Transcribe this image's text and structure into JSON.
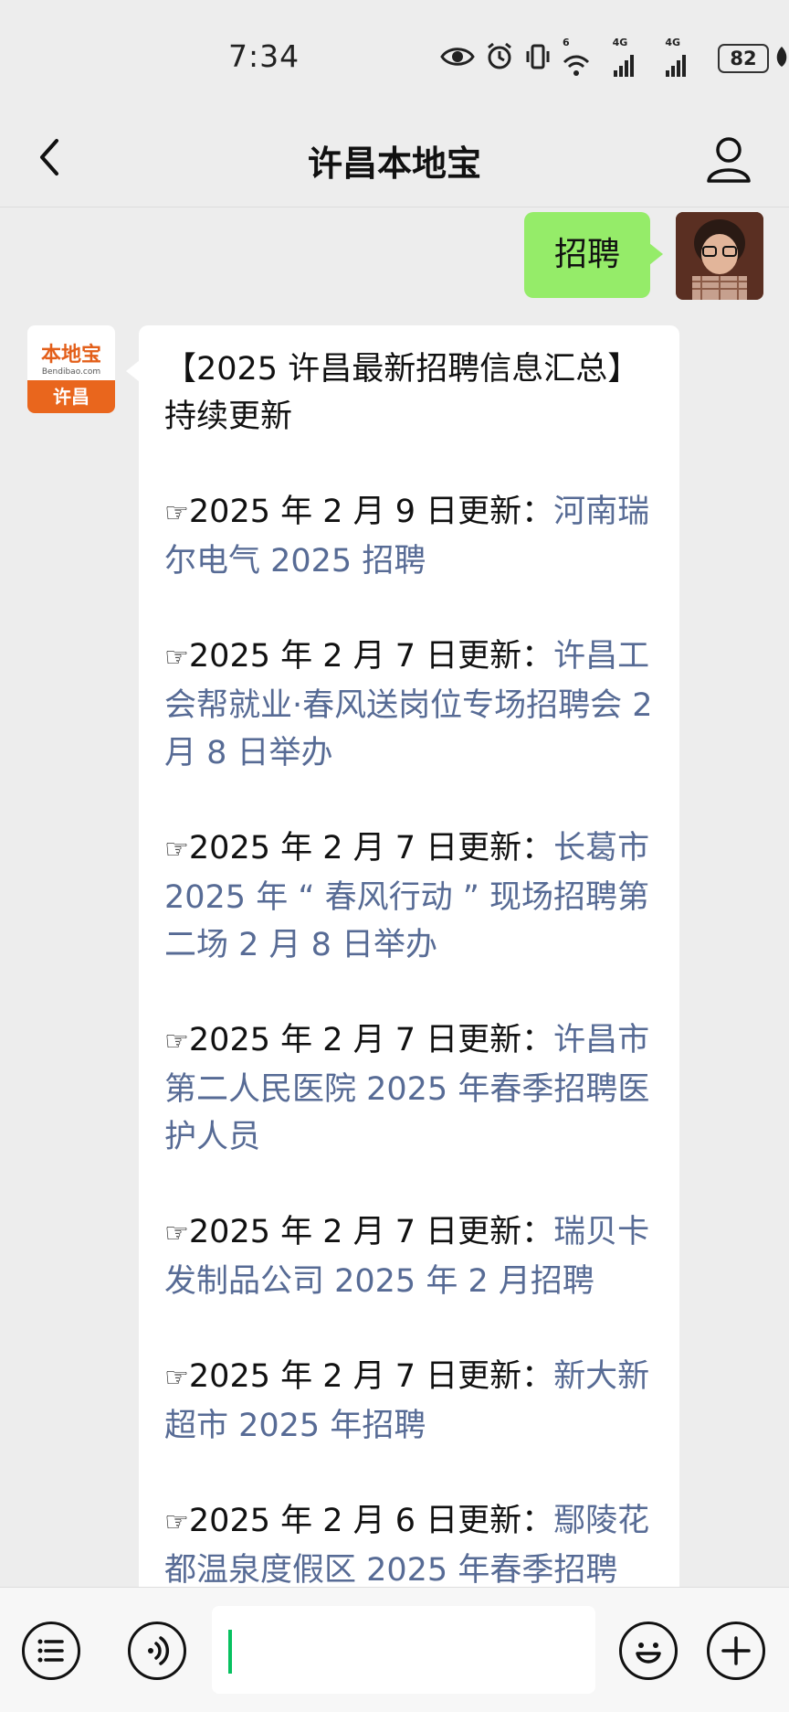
{
  "status_bar": {
    "time": "7:34",
    "signal_badge_1": "4G",
    "signal_badge_2": "4G",
    "wifi_badge": "6",
    "battery": "82"
  },
  "header": {
    "title": "许昌本地宝"
  },
  "user_message": {
    "text": "招聘"
  },
  "bot_avatar": {
    "top_text": "本地宝",
    "url_text": "Bendibao.com",
    "bottom_text": "许昌"
  },
  "bot_message": {
    "title": "【2025 许昌最新招聘信息汇总】持续更新",
    "hand_glyph": "☞",
    "entries": [
      {
        "date": "2025 年 2 月 9 日更新：",
        "link": "河南瑞尔电气 2025 招聘"
      },
      {
        "date": "2025 年 2 月 7 日更新：",
        "link": "许昌工会帮就业·春风送岗位专场招聘会 2 月 8 日举办"
      },
      {
        "date": "2025 年 2 月 7 日更新：",
        "link": "长葛市 2025 年 “ 春风行动 ” 现场招聘第二场 2 月 8 日举办"
      },
      {
        "date": "2025 年 2 月 7 日更新：",
        "link": "许昌市第二人民医院 2025 年春季招聘医护人员"
      },
      {
        "date": "2025 年 2 月 7 日更新：",
        "link": "瑞贝卡发制品公司 2025 年 2 月招聘"
      },
      {
        "date": "2025 年 2 月 7 日更新：",
        "link": "新大新超市 2025 年招聘"
      },
      {
        "date": "2025 年 2 月 6 日更新：",
        "link": "鄢陵花都温泉度假区 2025 年春季招聘"
      }
    ]
  },
  "colors": {
    "link": "#576b95",
    "user_bubble": "#95ec69",
    "caret": "#07c160"
  }
}
